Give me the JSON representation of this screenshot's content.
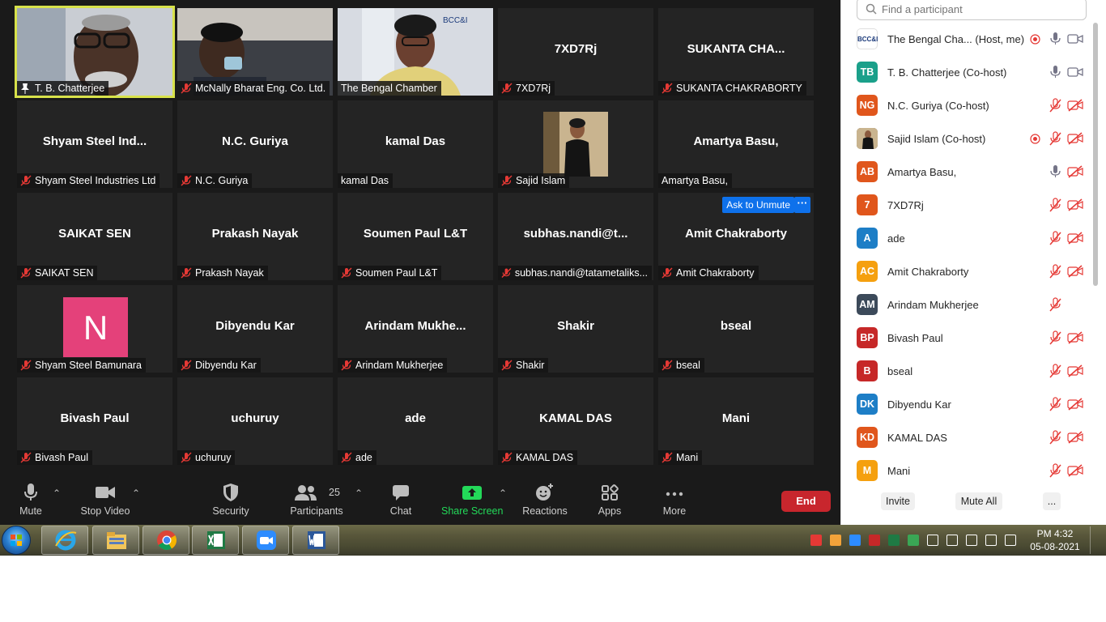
{
  "tiles": [
    {
      "label": "T. B. Chatterjee",
      "center": "",
      "photo": "tb",
      "active": true,
      "pinned": true
    },
    {
      "label": "McNally Bharat Eng. Co. Ltd.",
      "center": "",
      "photo": "mcnally"
    },
    {
      "label": "The Bengal Chamber",
      "center": "",
      "photo": "bengal",
      "nomic": true
    },
    {
      "label": "7XD7Rj",
      "center": "7XD7Rj"
    },
    {
      "label": "SUKANTA CHAKRABORTY",
      "center": "SUKANTA CHA..."
    },
    {
      "label": "Shyam Steel Industries Ltd",
      "center": "Shyam Steel Ind..."
    },
    {
      "label": "N.C. Guriya",
      "center": "N.C. Guriya"
    },
    {
      "label": "kamal Das",
      "center": "kamal Das",
      "nomic": true
    },
    {
      "label": "Sajid Islam",
      "center": "",
      "photo": "sajid"
    },
    {
      "label": "Amartya Basu,",
      "center": "Amartya Basu,",
      "nomic": true
    },
    {
      "label": "SAIKAT SEN",
      "center": "SAIKAT SEN"
    },
    {
      "label": "Prakash Nayak",
      "center": "Prakash Nayak"
    },
    {
      "label": "Soumen Paul L&T",
      "center": "Soumen Paul L&T"
    },
    {
      "label": "subhas.nandi@tatametaliks...",
      "center": "subhas.nandi@t..."
    },
    {
      "label": "Amit Chakraborty",
      "center": "Amit Chakraborty",
      "ask": true
    },
    {
      "label": "Shyam Steel Bamunara",
      "center": "",
      "avatar": "N"
    },
    {
      "label": "Dibyendu Kar",
      "center": "Dibyendu Kar"
    },
    {
      "label": "Arindam Mukherjee",
      "center": "Arindam  Mukhe..."
    },
    {
      "label": "Shakir",
      "center": "Shakir"
    },
    {
      "label": "bseal",
      "center": "bseal"
    },
    {
      "label": "Bivash Paul",
      "center": "Bivash Paul"
    },
    {
      "label": "uchuruy",
      "center": "uchuruy"
    },
    {
      "label": "ade",
      "center": "ade"
    },
    {
      "label": "KAMAL DAS",
      "center": "KAMAL DAS"
    },
    {
      "label": "Mani",
      "center": "Mani"
    }
  ],
  "ask_to_unmute": "Ask to Unmute",
  "more_dots": "···",
  "toolbar": {
    "mute": "Mute",
    "stop_video": "Stop Video",
    "security": "Security",
    "participants": "Participants",
    "participant_count": "25",
    "chat": "Chat",
    "share_screen": "Share Screen",
    "reactions": "Reactions",
    "apps": "Apps",
    "more": "More",
    "end": "End"
  },
  "panel": {
    "search_placeholder": "Find a participant",
    "invite": "Invite",
    "mute_all": "Mute All",
    "more": "...",
    "participants": [
      {
        "initials": "BCC&I",
        "name": "The Bengal Cha...  (Host, me)",
        "color": "#ffffff",
        "rec": true,
        "mic": "on",
        "video": "on",
        "logo": true
      },
      {
        "initials": "TB",
        "name": "T. B. Chatterjee (Co-host)",
        "color": "#1aa08a",
        "rec": false,
        "mic": "on",
        "video": "on"
      },
      {
        "initials": "NG",
        "name": "N.C. Guriya (Co-host)",
        "color": "#e0561c",
        "rec": false,
        "mic": "off",
        "video": "off"
      },
      {
        "initials": "",
        "name": "Sajid Islam (Co-host)",
        "color": "#6a5a3a",
        "rec": true,
        "mic": "off",
        "video": "off",
        "photo": true
      },
      {
        "initials": "AB",
        "name": "Amartya Basu,",
        "color": "#e0561c",
        "rec": false,
        "mic": "on",
        "video": "off"
      },
      {
        "initials": "7",
        "name": "7XD7Rj",
        "color": "#e0561c",
        "rec": false,
        "mic": "off",
        "video": "off"
      },
      {
        "initials": "A",
        "name": "ade",
        "color": "#1d7ec6",
        "rec": false,
        "mic": "off",
        "video": "off"
      },
      {
        "initials": "AC",
        "name": "Amit Chakraborty",
        "color": "#f5a00f",
        "rec": false,
        "mic": "off",
        "video": "off"
      },
      {
        "initials": "AM",
        "name": "Arindam Mukherjee",
        "color": "#3c4a5a",
        "rec": false,
        "mic": "off",
        "video": "none"
      },
      {
        "initials": "BP",
        "name": "Bivash Paul",
        "color": "#c62828",
        "rec": false,
        "mic": "off",
        "video": "off"
      },
      {
        "initials": "B",
        "name": "bseal",
        "color": "#c62828",
        "rec": false,
        "mic": "off",
        "video": "off"
      },
      {
        "initials": "DK",
        "name": "Dibyendu Kar",
        "color": "#1d7ec6",
        "rec": false,
        "mic": "off",
        "video": "off"
      },
      {
        "initials": "KD",
        "name": "KAMAL DAS",
        "color": "#e0561c",
        "rec": false,
        "mic": "off",
        "video": "off"
      },
      {
        "initials": "M",
        "name": "Mani",
        "color": "#f5a00f",
        "rec": false,
        "mic": "off",
        "video": "off"
      }
    ]
  },
  "taskbar": {
    "apps": [
      "internet-explorer-icon",
      "file-explorer-icon",
      "chrome-icon",
      "excel-icon",
      "zoom-icon",
      "word-icon"
    ],
    "time": "PM 4:32",
    "date": "05-08-2021"
  }
}
